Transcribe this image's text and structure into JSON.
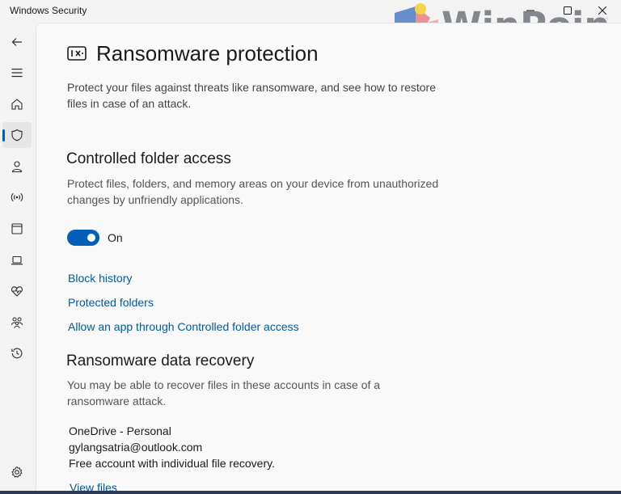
{
  "window": {
    "app_title": "Windows Security",
    "watermark_text": "WinPoin"
  },
  "nav": {
    "items": [
      {
        "icon": "back-arrow-icon"
      },
      {
        "icon": "menu-icon"
      },
      {
        "icon": "home-icon"
      },
      {
        "icon": "shield-icon",
        "active": true
      },
      {
        "icon": "person-icon"
      },
      {
        "icon": "network-icon"
      },
      {
        "icon": "app-browser-icon"
      },
      {
        "icon": "laptop-icon"
      },
      {
        "icon": "heart-pulse-icon"
      },
      {
        "icon": "family-icon"
      },
      {
        "icon": "history-icon"
      },
      {
        "icon": "gear-icon"
      }
    ]
  },
  "page": {
    "title": "Ransomware protection",
    "description": "Protect your files against threats like ransomware, and see how to restore files in case of an attack."
  },
  "cfa": {
    "title": "Controlled folder access",
    "description": "Protect files, folders, and memory areas on your device from unauthorized changes by unfriendly applications.",
    "toggle_state": "On",
    "toggle_on": true,
    "links": {
      "block_history": "Block history",
      "protected_folders": "Protected folders",
      "allow_app": "Allow an app through Controlled folder access"
    }
  },
  "recovery": {
    "title": "Ransomware data recovery",
    "description": "You may be able to recover files in these accounts in case of a ransomware attack.",
    "account_name": "OneDrive - Personal",
    "account_email": "gylangsatria@outlook.com",
    "account_type": "Free account with individual file recovery.",
    "view_files": "View files"
  },
  "colors": {
    "accent": "#005fb8",
    "link": "#005a9e"
  }
}
